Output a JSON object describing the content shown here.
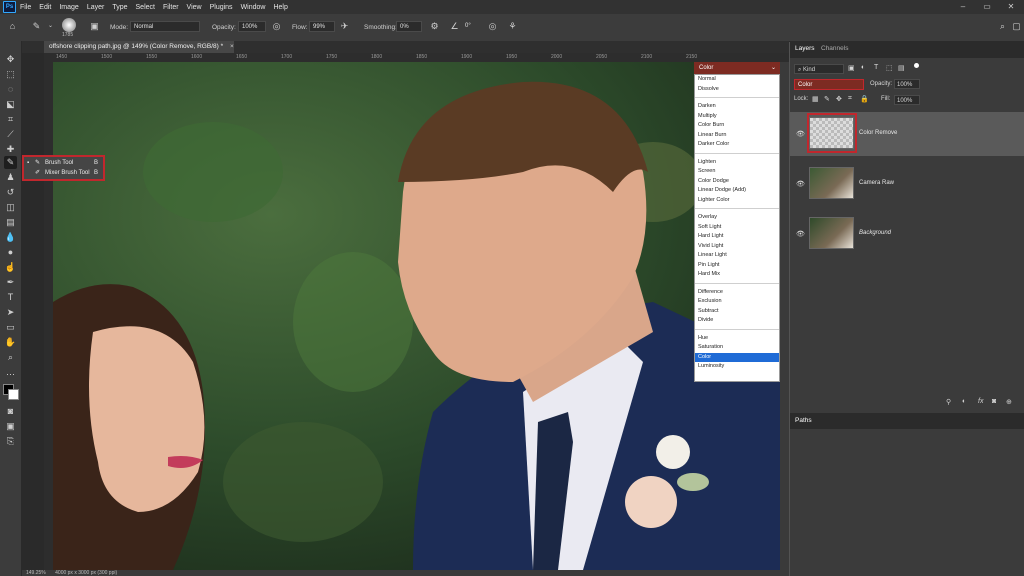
{
  "menu": {
    "logo": "Ps",
    "items": [
      "File",
      "Edit",
      "Image",
      "Layer",
      "Type",
      "Select",
      "Filter",
      "View",
      "Plugins",
      "Window",
      "Help"
    ]
  },
  "options": {
    "brush_size": "1785",
    "mode_label": "Mode:",
    "mode_value": "Normal",
    "opacity_label": "Opacity:",
    "opacity_value": "100%",
    "flow_label": "Flow:",
    "flow_value": "99%",
    "smoothing_label": "Smoothing:",
    "smoothing_value": "0%",
    "angle_value": "0°"
  },
  "document": {
    "tab_title": "offshore clipping path.jpg @ 149% (Color Remove, RGB/8) *",
    "tab_close": "×",
    "ruler_marks": [
      "1450",
      "1500",
      "1550",
      "1600",
      "1650",
      "1700",
      "1750",
      "1800",
      "1850",
      "1900",
      "1950",
      "2000",
      "2050",
      "2100",
      "2150"
    ],
    "status_zoom": "149.25%",
    "status_info": "4000 px x 3000 px (300 ppi)"
  },
  "flyout": {
    "items": [
      {
        "label": "Brush Tool",
        "shortcut": "B"
      },
      {
        "label": "Mixer Brush Tool",
        "shortcut": "B"
      }
    ]
  },
  "blend": {
    "current": "Color",
    "groups": [
      [
        "Normal",
        "Dissolve"
      ],
      [
        "Darken",
        "Multiply",
        "Color Burn",
        "Linear Burn",
        "Darker Color"
      ],
      [
        "Lighten",
        "Screen",
        "Color Dodge",
        "Linear Dodge (Add)",
        "Lighter Color"
      ],
      [
        "Overlay",
        "Soft Light",
        "Hard Light",
        "Vivid Light",
        "Linear Light",
        "Pin Light",
        "Hard Mix"
      ],
      [
        "Difference",
        "Exclusion",
        "Subtract",
        "Divide"
      ],
      [
        "Hue",
        "Saturation",
        "Color",
        "Luminosity"
      ]
    ],
    "selected": "Color"
  },
  "layers_panel": {
    "tabs": [
      "Layers",
      "Channels"
    ],
    "filter_kind": "Kind",
    "blend_value": "Color",
    "opacity_label": "Opacity:",
    "opacity_value": "100%",
    "lock_label": "Lock:",
    "fill_label": "Fill:",
    "fill_value": "100%",
    "layers": [
      {
        "name": "Color Remove",
        "selected": true
      },
      {
        "name": "Camera Raw",
        "selected": false
      },
      {
        "name": "Background",
        "selected": false
      }
    ],
    "footer_icons": [
      "link-icon",
      "fx-icon",
      "mask-icon",
      "adjustment-icon",
      "group-icon",
      "new-layer-icon",
      "trash-icon"
    ]
  },
  "paths_panel": {
    "title": "Paths"
  },
  "colors": {
    "accent_red": "#c1272d",
    "selection_blue": "#1f6bd6"
  }
}
